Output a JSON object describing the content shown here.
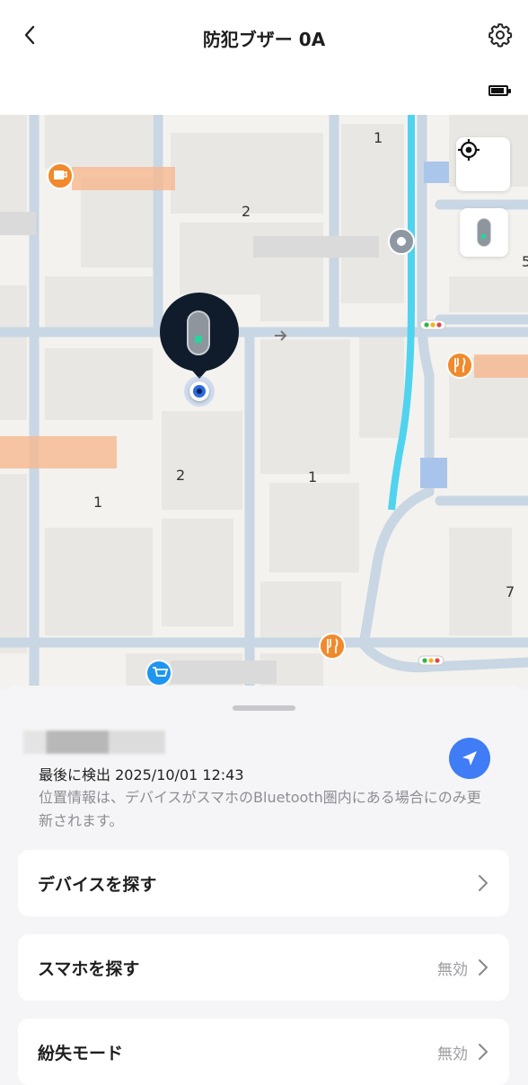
{
  "header": {
    "title": "防犯ブザー 0A",
    "battery_level": 0.85
  },
  "map": {
    "block_numbers": [
      "1",
      "2",
      "2",
      "1",
      "1",
      "7",
      "5"
    ],
    "poi_icons": [
      "cafe-icon",
      "restaurant-icon",
      "restaurant-icon",
      "shopping-cart-icon",
      "location-pin-icon"
    ],
    "buttons": [
      "my-location-icon",
      "device-locate-icon"
    ]
  },
  "sheet": {
    "last_seen": "最後に検出 2025/10/01 12:43",
    "info_text": "位置情報は、デバイスがスマホのBluetooth圏内にある場合にのみ更新されます。",
    "rows": [
      {
        "label": "デバイスを探す",
        "status": ""
      },
      {
        "label": "スマホを探す",
        "status": "無効"
      },
      {
        "label": "紛失モード",
        "status": "無効"
      }
    ]
  },
  "colors": {
    "accent": "#3f7cf5",
    "poi_orange": "#f08a2c",
    "water": "#4fd3ee",
    "road": "#c9d6e3"
  }
}
